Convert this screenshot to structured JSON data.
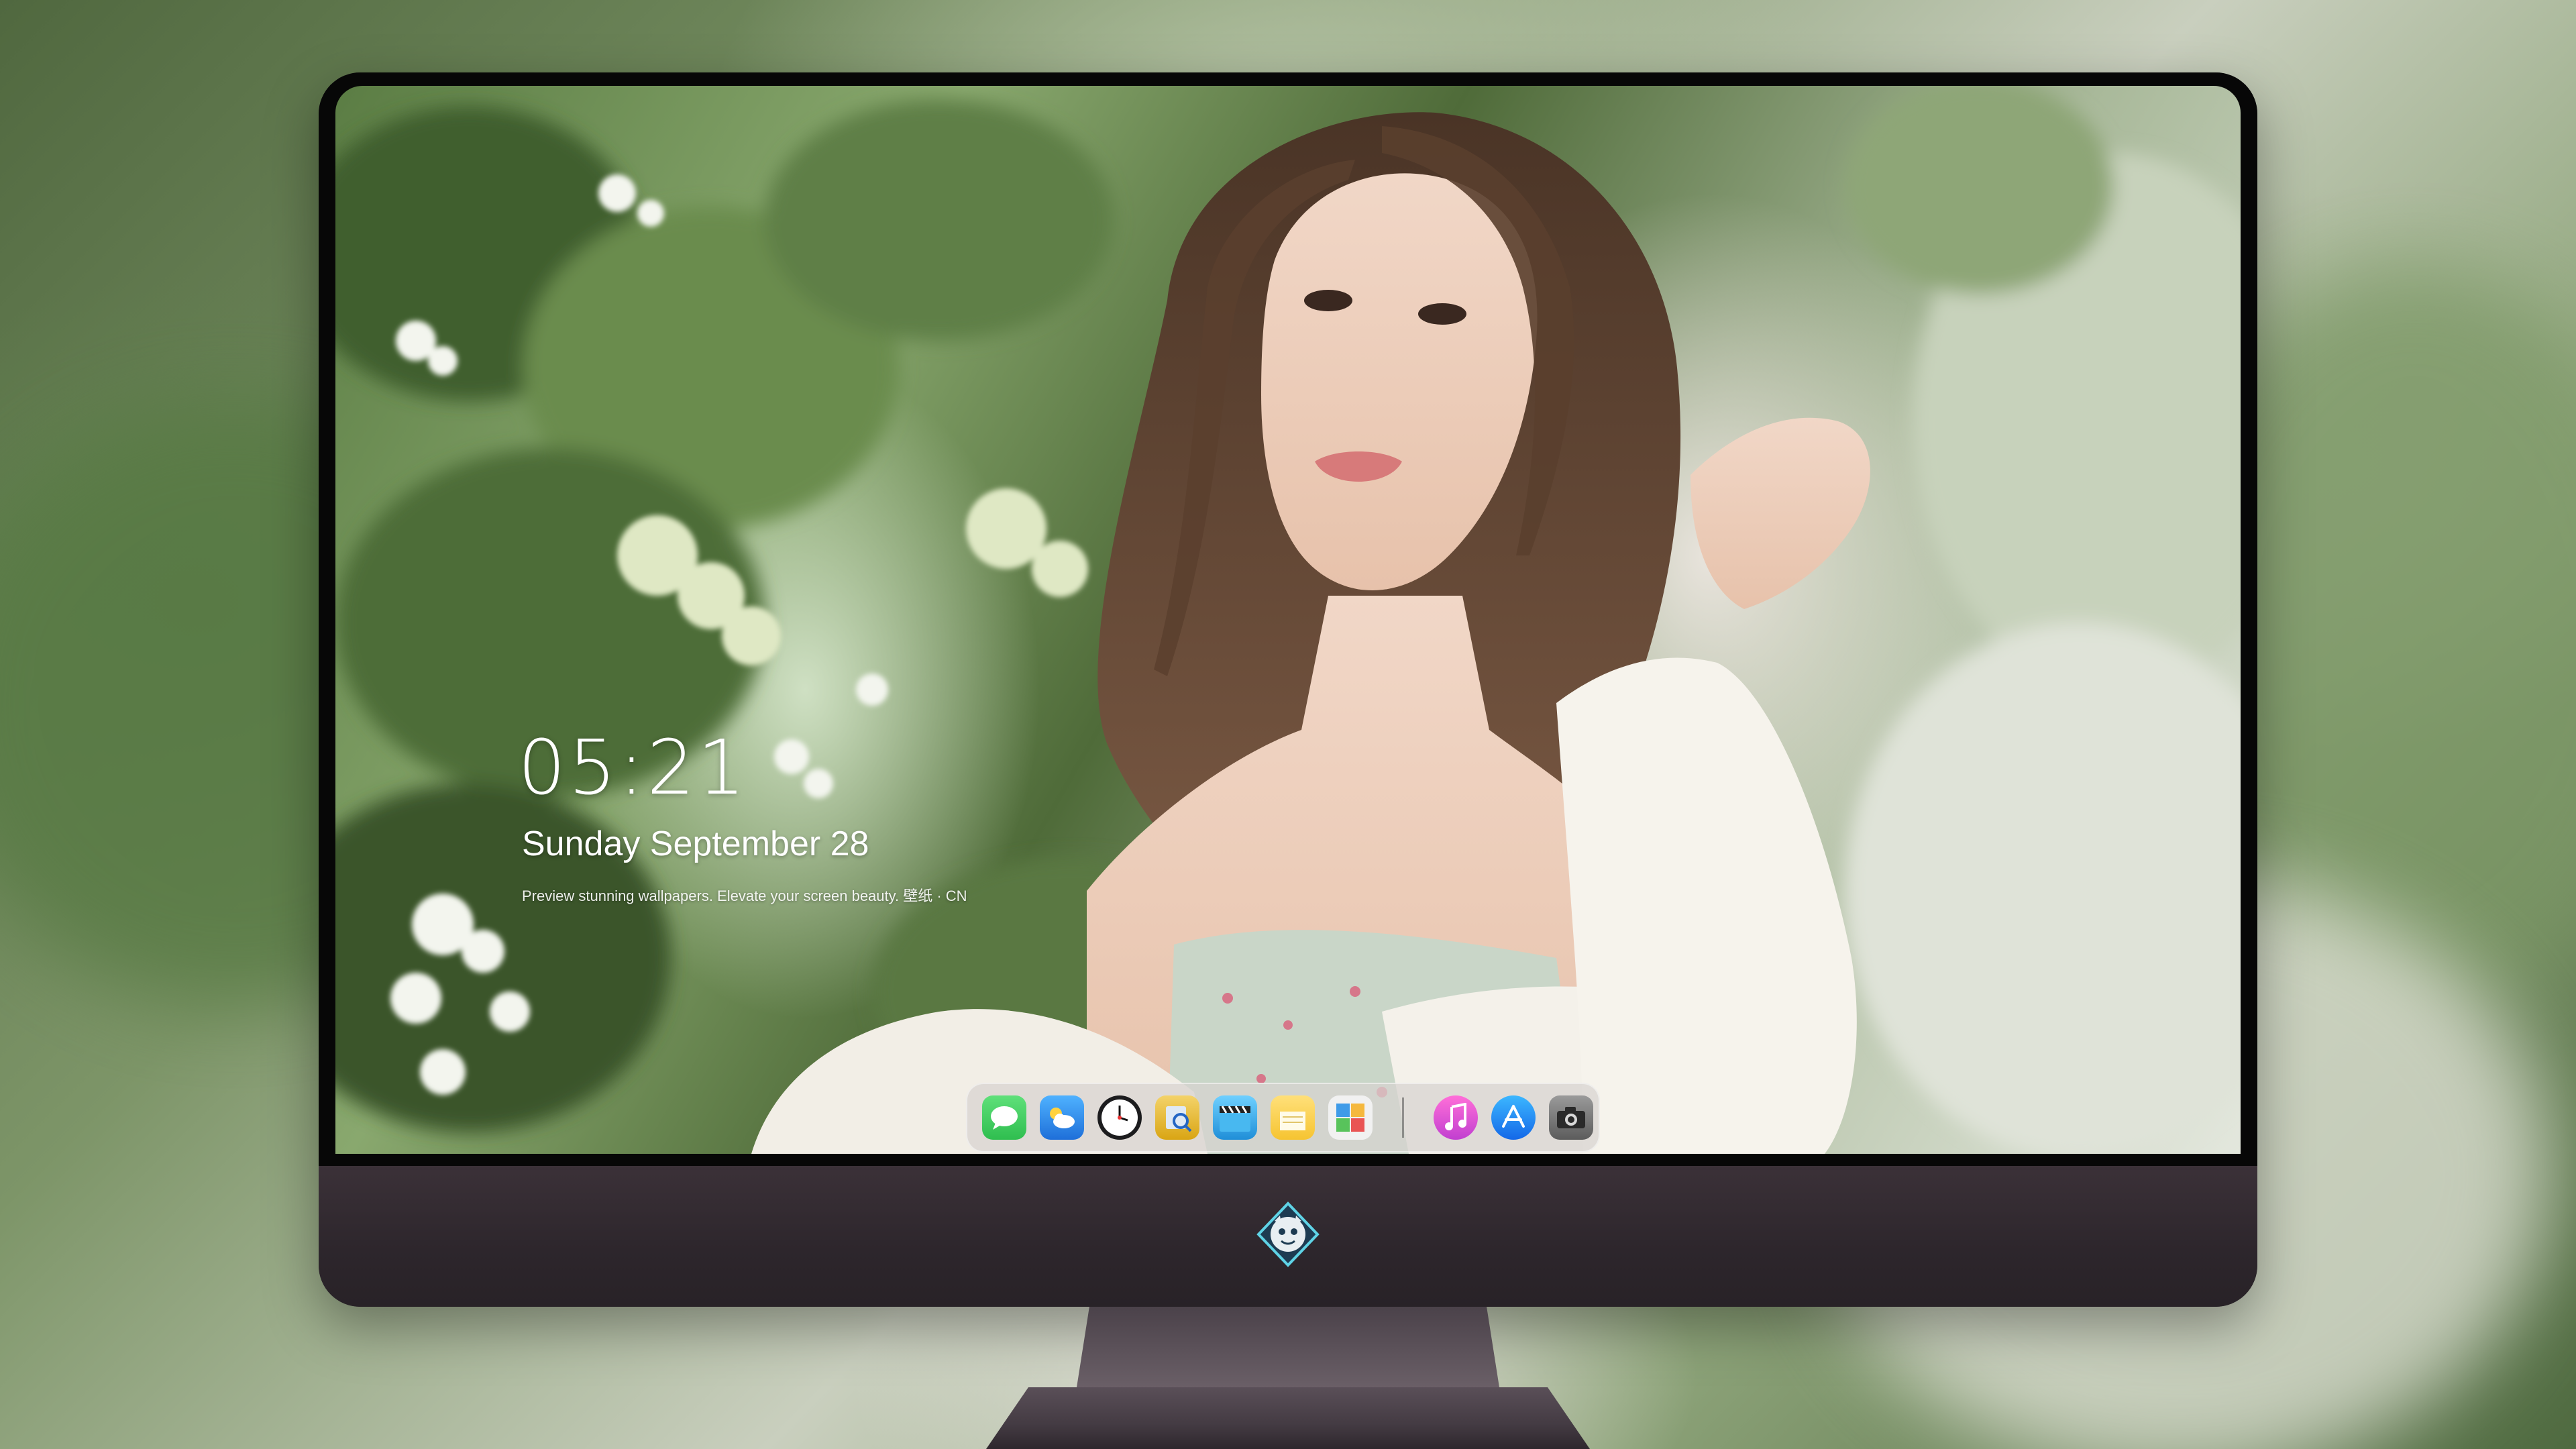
{
  "lock_screen": {
    "time": "05:21",
    "date": "Sunday September  28",
    "tagline": "Preview stunning wallpapers. Elevate your screen beauty. 壁纸 · CN"
  },
  "dock": {
    "apps": [
      {
        "name": "messages",
        "icon": "message-bubble-icon",
        "color": "#34c759"
      },
      {
        "name": "weather",
        "icon": "cloud-icon",
        "color": "#2e8ff0"
      },
      {
        "name": "clock",
        "icon": "clock-icon",
        "color": "#1c1c1e"
      },
      {
        "name": "preview",
        "icon": "preview-icon",
        "color": "#f1c40f"
      },
      {
        "name": "videos",
        "icon": "clapperboard-icon",
        "color": "#38a7e8"
      },
      {
        "name": "notes",
        "icon": "notes-icon",
        "color": "#f9d548"
      },
      {
        "name": "photos",
        "icon": "photo-grid-icon",
        "color": "#e9e9e9"
      },
      {
        "name": "music",
        "icon": "music-note-icon",
        "color": "#e44fd0"
      },
      {
        "name": "app-store",
        "icon": "app-store-icon",
        "color": "#1a8cff"
      },
      {
        "name": "camera",
        "icon": "camera-icon",
        "color": "#8a8a8a"
      }
    ]
  },
  "monitor": {
    "bezel_color": "#070707",
    "chin_color": "#2d262c",
    "logo": "mascot-logo-icon"
  }
}
